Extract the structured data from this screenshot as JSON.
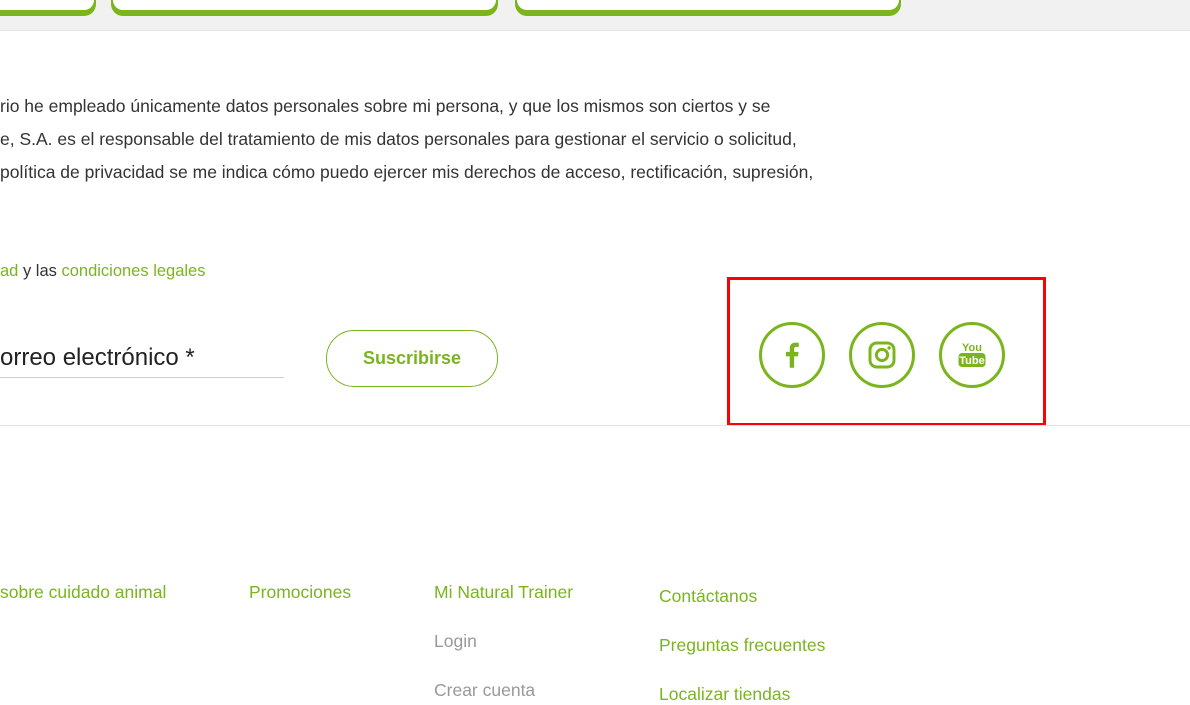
{
  "privacy_paragraph": [
    "rio he empleado únicamente datos personales sobre mi persona, y que los mismos son ciertos y se",
    "e, S.A. es el responsable del tratamiento de mis datos personales para gestionar el servicio o solicitud,",
    " política de privacidad se me indica cómo puedo ejercer mis derechos de acceso, rectificación, supresión,"
  ],
  "legal": {
    "link1": "ad",
    "connector1": " y las ",
    "link2": "condiciones legales"
  },
  "newsletter": {
    "email_placeholder": "orreo electrónico *",
    "subscribe_label": "Suscribirse"
  },
  "social": {
    "icons": [
      "facebook-icon",
      "instagram-icon",
      "youtube-icon"
    ],
    "youtube_text_top": "You",
    "youtube_text_bottom": "Tube"
  },
  "footer": {
    "col1": [
      "sobre cuidado animal"
    ],
    "col2": [
      "Promociones"
    ],
    "col3": [
      "Mi Natural Trainer",
      "Login",
      "Crear cuenta"
    ],
    "col4": [
      "Contáctanos",
      "Preguntas frecuentes",
      "Localizar tiendas"
    ]
  },
  "colors": {
    "accent": "#7ab51d",
    "highlight": "#ff0000",
    "text": "#333333",
    "muted": "#999999"
  }
}
